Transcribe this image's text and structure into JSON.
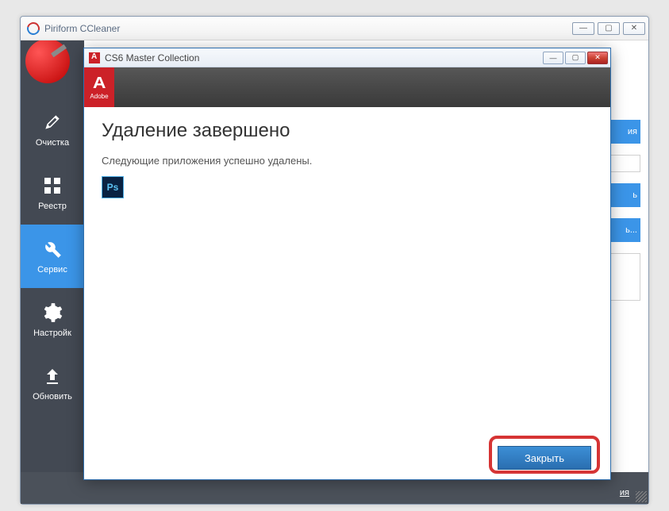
{
  "main_window": {
    "title": "Piriform CCleaner",
    "footer_link": "ия"
  },
  "sidebar": {
    "items": [
      {
        "label": "Очистка"
      },
      {
        "label": "Реестр"
      },
      {
        "label": "Сервис"
      },
      {
        "label": "Настройк"
      },
      {
        "label": "Обновить"
      }
    ]
  },
  "side_blocks": {
    "b1": "ия",
    "b2": "ь",
    "b3": "ь...",
    "b4": ""
  },
  "dialog": {
    "title": "CS6 Master Collection",
    "brand": "Adobe",
    "heading": "Удаление завершено",
    "message": "Следующие приложения успешно удалены.",
    "app_icon_label": "Ps",
    "close_button": "Закрыть"
  },
  "win_controls": {
    "min": "—",
    "max": "▢",
    "close": "✕"
  }
}
